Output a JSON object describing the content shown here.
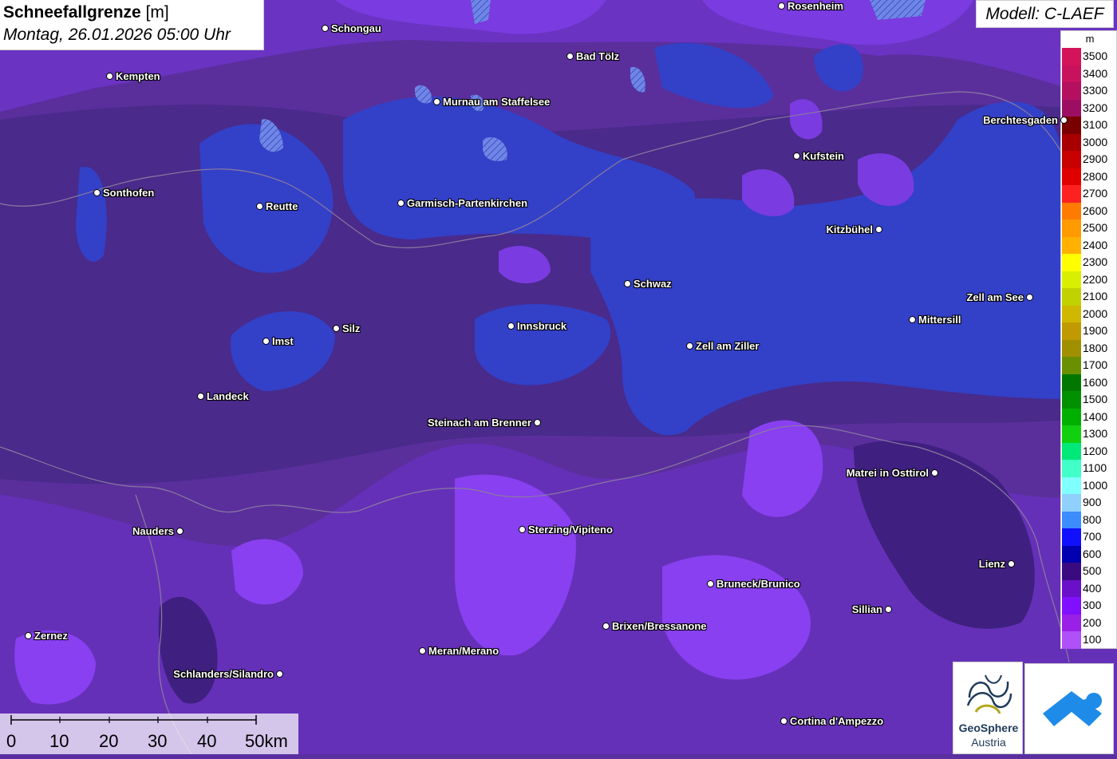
{
  "header": {
    "title_bold": "Schneefallgrenze",
    "title_unit": " [m]",
    "date": "Montag, 26.01.2026 05:00 Uhr",
    "model": "Modell: C-LAEF"
  },
  "legend": {
    "unit": "m",
    "items": [
      {
        "label": "3500",
        "color": "#d4145a"
      },
      {
        "label": "3400",
        "color": "#c8125e"
      },
      {
        "label": "3300",
        "color": "#b51060"
      },
      {
        "label": "3200",
        "color": "#9c0e62"
      },
      {
        "label": "3100",
        "color": "#7a0000"
      },
      {
        "label": "3000",
        "color": "#a80000"
      },
      {
        "label": "2900",
        "color": "#c80000"
      },
      {
        "label": "2800",
        "color": "#e00000"
      },
      {
        "label": "2700",
        "color": "#ff2020"
      },
      {
        "label": "2600",
        "color": "#ff7b00"
      },
      {
        "label": "2500",
        "color": "#ff9a00"
      },
      {
        "label": "2400",
        "color": "#ffb000"
      },
      {
        "label": "2300",
        "color": "#ffff00"
      },
      {
        "label": "2200",
        "color": "#d8f000"
      },
      {
        "label": "2100",
        "color": "#c2d200"
      },
      {
        "label": "2000",
        "color": "#d0b800"
      },
      {
        "label": "1900",
        "color": "#c09a00"
      },
      {
        "label": "1800",
        "color": "#a09000"
      },
      {
        "label": "1700",
        "color": "#6a9000"
      },
      {
        "label": "1600",
        "color": "#007800"
      },
      {
        "label": "1500",
        "color": "#009000"
      },
      {
        "label": "1400",
        "color": "#00b000"
      },
      {
        "label": "1300",
        "color": "#10d010"
      },
      {
        "label": "1200",
        "color": "#00e878"
      },
      {
        "label": "1100",
        "color": "#40ffc8"
      },
      {
        "label": "1000",
        "color": "#80ffff"
      },
      {
        "label": "900",
        "color": "#90d0ff"
      },
      {
        "label": "800",
        "color": "#3a8cff"
      },
      {
        "label": "700",
        "color": "#1010ff"
      },
      {
        "label": "600",
        "color": "#0000b0"
      },
      {
        "label": "500",
        "color": "#3a0a80"
      },
      {
        "label": "400",
        "color": "#6a10c8"
      },
      {
        "label": "300",
        "color": "#8010ff"
      },
      {
        "label": "200",
        "color": "#9a20e8"
      },
      {
        "label": "100",
        "color": "#b050f8"
      }
    ]
  },
  "cities": [
    {
      "name": "Rosenheim",
      "label_side": "right"
    },
    {
      "name": "Schongau",
      "label_side": "right"
    },
    {
      "name": "Kempten",
      "label_side": "right"
    },
    {
      "name": "Bad Tölz",
      "label_side": "right"
    },
    {
      "name": "Murnau am Staffelsee",
      "label_side": "right"
    },
    {
      "name": "Berchtesgaden",
      "label_side": "left"
    },
    {
      "name": "Kufstein",
      "label_side": "right"
    },
    {
      "name": "Sonthofen",
      "label_side": "right"
    },
    {
      "name": "Reutte",
      "label_side": "right"
    },
    {
      "name": "Garmisch-Partenkirchen",
      "label_side": "right"
    },
    {
      "name": "Kitzbühel",
      "label_side": "left"
    },
    {
      "name": "Schwaz",
      "label_side": "right"
    },
    {
      "name": "Zell am See",
      "label_side": "left"
    },
    {
      "name": "Mittersill",
      "label_side": "right"
    },
    {
      "name": "Innsbruck",
      "label_side": "right"
    },
    {
      "name": "Silz",
      "label_side": "right"
    },
    {
      "name": "Imst",
      "label_side": "right"
    },
    {
      "name": "Zell am Ziller",
      "label_side": "right"
    },
    {
      "name": "Landeck",
      "label_side": "right"
    },
    {
      "name": "Steinach am Brenner",
      "label_side": "left"
    },
    {
      "name": "Matrei in Osttirol",
      "label_side": "left"
    },
    {
      "name": "Nauders",
      "label_side": "left"
    },
    {
      "name": "Sterzing/Vipiteno",
      "label_side": "right"
    },
    {
      "name": "Lienz",
      "label_side": "left"
    },
    {
      "name": "Bruneck/Brunico",
      "label_side": "right"
    },
    {
      "name": "Sillian",
      "label_side": "left"
    },
    {
      "name": "Brixen/Bressanone",
      "label_side": "right"
    },
    {
      "name": "Zernez",
      "label_side": "right"
    },
    {
      "name": "Meran/Merano",
      "label_side": "right"
    },
    {
      "name": "Schlanders/Silandro",
      "label_side": "left"
    },
    {
      "name": "Cortina d'Ampezzo",
      "label_side": "right"
    }
  ],
  "scale": {
    "labels": [
      "0",
      "10",
      "20",
      "30",
      "40",
      "50km"
    ]
  },
  "logos": {
    "geosphere_line1": "GeoSphere",
    "geosphere_line2": "Austria"
  }
}
